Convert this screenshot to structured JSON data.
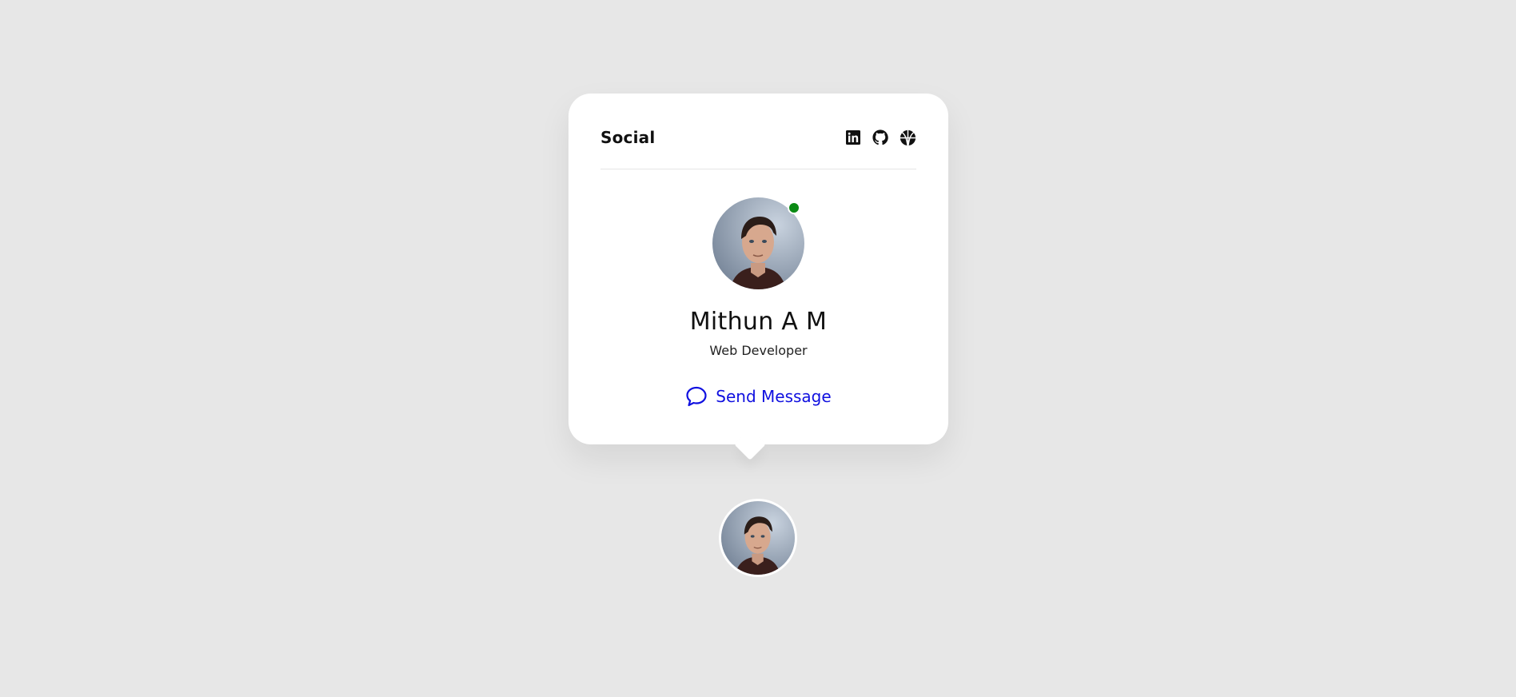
{
  "card": {
    "title": "Social",
    "social_links": [
      {
        "icon": "linkedin-icon"
      },
      {
        "icon": "github-icon"
      },
      {
        "icon": "dribbble-icon"
      }
    ],
    "profile": {
      "name": "Mithun A M",
      "role": "Web Developer",
      "status": "online"
    },
    "action": {
      "label": "Send Message",
      "icon": "chat-bubble-icon"
    }
  },
  "colors": {
    "background": "#e7e7e7",
    "card": "#ffffff",
    "accent": "#1010e0",
    "online": "#0a8a14"
  }
}
